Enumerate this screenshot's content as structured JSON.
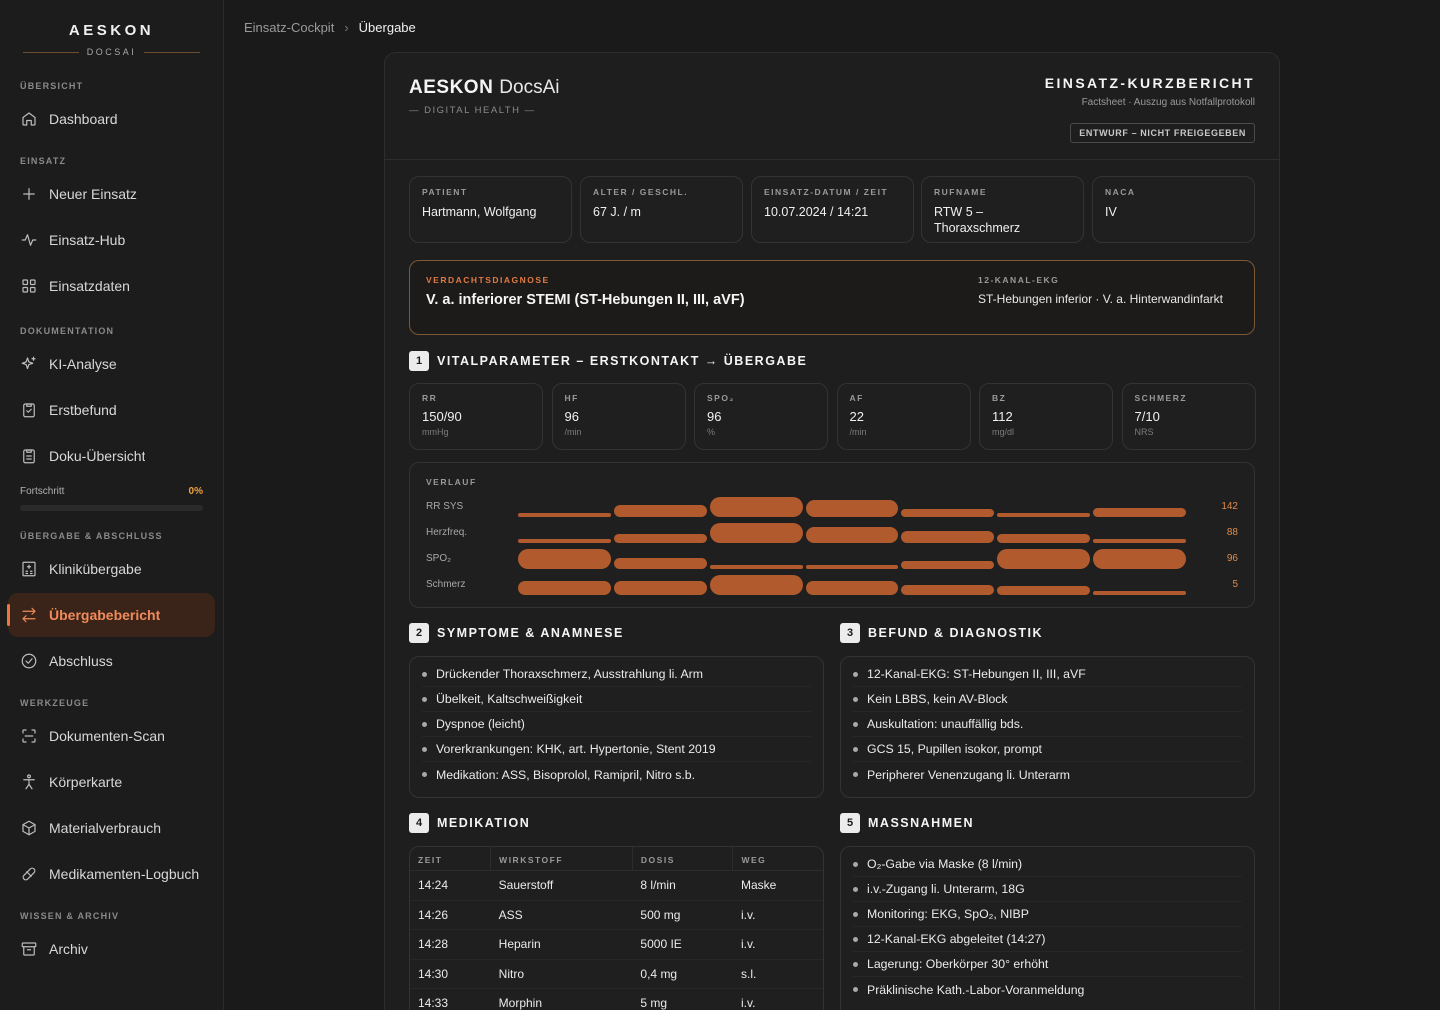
{
  "sidebar": {
    "logo_title": "AESKON",
    "logo_sub": "DOCSAI",
    "sections": {
      "overview": "ÜBERSICHT",
      "mission": "EINSATZ",
      "documentation": "DOKUMENTATION",
      "handover": "ÜBERGABE & ABSCHLUSS",
      "tools": "WERKZEUGE",
      "knowledge": "WISSEN & ARCHIV"
    },
    "items": {
      "dashboard": "Dashboard",
      "new_mission": "Neuer Einsatz",
      "mission_hub": "Einsatz-Hub",
      "mission_data": "Einsatzdaten",
      "ai_analysis": "KI-Analyse",
      "first_findings": "Erstbefund",
      "doc_overview": "Doku-Übersicht",
      "clinic_handover": "Klinikübergabe",
      "handover_report": "Übergabebericht",
      "closing": "Abschluss",
      "doc_scan": "Dokumenten-Scan",
      "body_map": "Körperkarte",
      "material_usage": "Materialverbrauch",
      "med_log": "Medikamenten-Logbuch",
      "archive": "Archiv"
    },
    "progress": {
      "label": "Fortschritt",
      "value": "0%"
    }
  },
  "breadcrumb": {
    "parent": "Einsatz-Cockpit",
    "current": "Übergabe"
  },
  "report": {
    "brand_bold": "AESKON",
    "brand_light": "DocsAi",
    "brand_sub": "— DIGITAL HEALTH —",
    "title": "EINSATZ-KURZBERICHT",
    "subtitle": "Factsheet · Auszug aus Notfallprotokoll",
    "badge": "ENTWURF – NICHT FREIGEGEBEN",
    "facts": [
      {
        "label": "PATIENT",
        "value": "Hartmann, Wolfgang"
      },
      {
        "label": "ALTER / GESCHL.",
        "value": "67 J. / m"
      },
      {
        "label": "EINSATZ-DATUM / ZEIT",
        "value": "10.07.2024 / 14:21"
      },
      {
        "label": "RUFNAME",
        "value": "RTW 5 – Thoraxschmerz"
      },
      {
        "label": "NACA",
        "value": "IV"
      }
    ],
    "diagnosis": {
      "label": "VERDACHTSDIAGNOSE",
      "value": "V. a. inferiorer STEMI (ST-Hebungen II, III, aVF)",
      "ekg_label": "12-KANAL-EKG",
      "ekg_value": "ST-Hebungen inferior · V. a. Hinterwandinfarkt"
    },
    "sections": {
      "vitals": {
        "num": "1",
        "title": "VITALPARAMETER – ERSTKONTAKT → ÜBERGABE"
      },
      "symptoms": {
        "num": "2",
        "title": "SYMPTOME & ANAMNESE"
      },
      "findings": {
        "num": "3",
        "title": "BEFUND & DIAGNOSTIK"
      },
      "medication": {
        "num": "4",
        "title": "MEDIKATION"
      },
      "measures": {
        "num": "5",
        "title": "MASSNAHMEN"
      }
    },
    "vitals": [
      {
        "label": "RR",
        "value": "150/90",
        "unit": "mmHg"
      },
      {
        "label": "HF",
        "value": "96",
        "unit": "/min"
      },
      {
        "label": "SPO₂",
        "value": "96",
        "unit": "%"
      },
      {
        "label": "AF",
        "value": "22",
        "unit": "/min"
      },
      {
        "label": "BZ",
        "value": "112",
        "unit": "mg/dl"
      },
      {
        "label": "SCHMERZ",
        "value": "7/10",
        "unit": "NRS"
      }
    ],
    "trend": {
      "title": "VERLAUF",
      "rows": [
        {
          "name": "RR SYS",
          "value": "142",
          "levels": [
            0.2,
            0.6,
            1.0,
            0.85,
            0.4,
            0.2,
            0.45
          ]
        },
        {
          "name": "Herzfreq.",
          "value": "88",
          "levels": [
            0.15,
            0.45,
            1.0,
            0.8,
            0.6,
            0.45,
            0.2
          ]
        },
        {
          "name": "SPO₂",
          "value": "96",
          "levels": [
            1.0,
            0.55,
            0.2,
            0.15,
            0.4,
            1.0,
            1.0
          ]
        },
        {
          "name": "Schmerz",
          "value": "5",
          "levels": [
            0.7,
            0.7,
            1.0,
            0.7,
            0.5,
            0.45,
            0.2
          ]
        }
      ]
    },
    "symptoms": [
      "Drückender Thoraxschmerz, Ausstrahlung li. Arm",
      "Übelkeit, Kaltschweißigkeit",
      "Dyspnoe (leicht)",
      "Vorerkrankungen: KHK, art. Hypertonie, Stent 2019",
      "Medikation: ASS, Bisoprolol, Ramipril, Nitro s.b."
    ],
    "findings": [
      "12-Kanal-EKG: ST-Hebungen II, III, aVF",
      "Kein LBBS, kein AV-Block",
      "Auskultation: unauffällig bds.",
      "GCS 15, Pupillen isokor, prompt",
      "Peripherer Venenzugang li. Unterarm"
    ],
    "medication": {
      "headers": [
        "ZEIT",
        "WIRKSTOFF",
        "DOSIS",
        "WEG"
      ],
      "rows": [
        [
          "14:24",
          "Sauerstoff",
          "8 l/min",
          "Maske"
        ],
        [
          "14:26",
          "ASS",
          "500 mg",
          "i.v."
        ],
        [
          "14:28",
          "Heparin",
          "5000 IE",
          "i.v."
        ],
        [
          "14:30",
          "Nitro",
          "0,4 mg",
          "s.l."
        ],
        [
          "14:33",
          "Morphin",
          "5 mg",
          "i.v."
        ]
      ]
    },
    "measures": [
      "O₂-Gabe via Maske (8 l/min)",
      "i.v.-Zugang li. Unterarm, 18G",
      "Monitoring: EKG, SpO₂, NIBP",
      "12-Kanal-EKG abgeleitet (14:27)",
      "Lagerung: Oberkörper 30° erhöht",
      "Präklinische Kath.-Labor-Voranmeldung"
    ]
  }
}
